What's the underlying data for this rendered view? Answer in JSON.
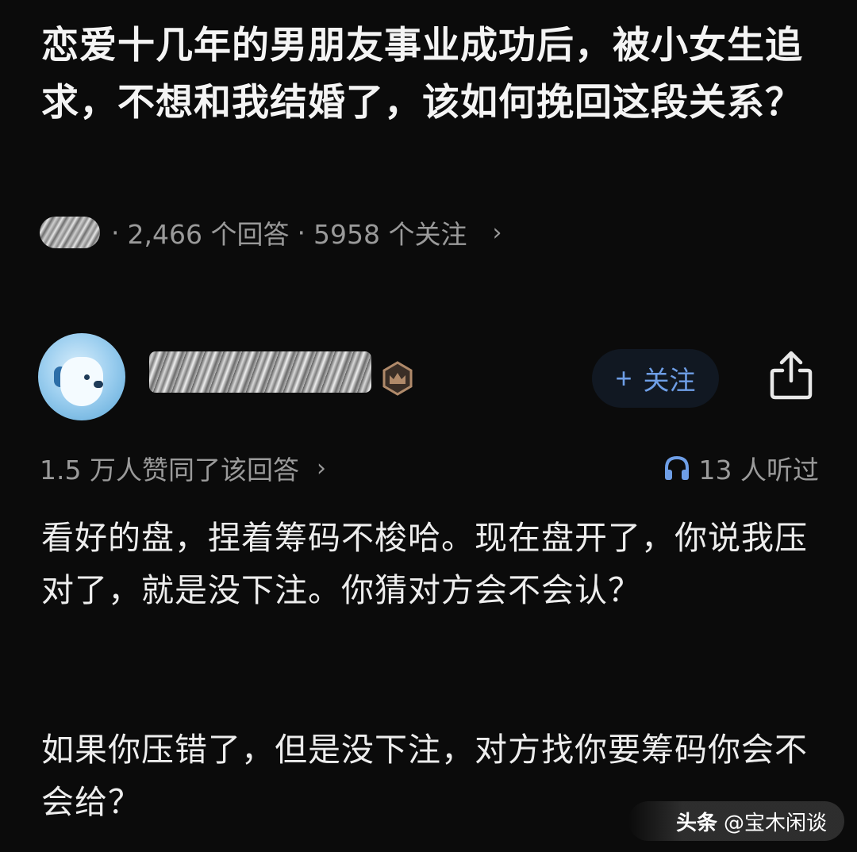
{
  "question": {
    "title": "恋爱十几年的男朋友事业成功后，被小女生追求，不想和我结婚了，该如何挽回这段关系？",
    "separator": "·",
    "answers_count": "2,466 个回答",
    "followers_count": "5958 个关注",
    "chevron": "›"
  },
  "author": {
    "follow_plus": "+",
    "follow_label": "关注"
  },
  "answer": {
    "approvals": "1.5 万人赞同了该回答",
    "chevron": "›",
    "listens": "13 人听过",
    "paragraphs": [
      "看好的盘，捏着筹码不梭哈。现在盘开了，你说我压对了，就是没下注。你猜对方会不会认？",
      "如果你压错了，但是没下注，对方找你要筹码你会不会给？"
    ]
  },
  "watermark": {
    "brand": "头条",
    "handle": "@宝木闲谈"
  },
  "colors": {
    "background": "#0b0b0b",
    "accent_blue": "#6e9ee6",
    "muted_text": "#9a9a9a",
    "badge_brown": "#b08a6a"
  }
}
